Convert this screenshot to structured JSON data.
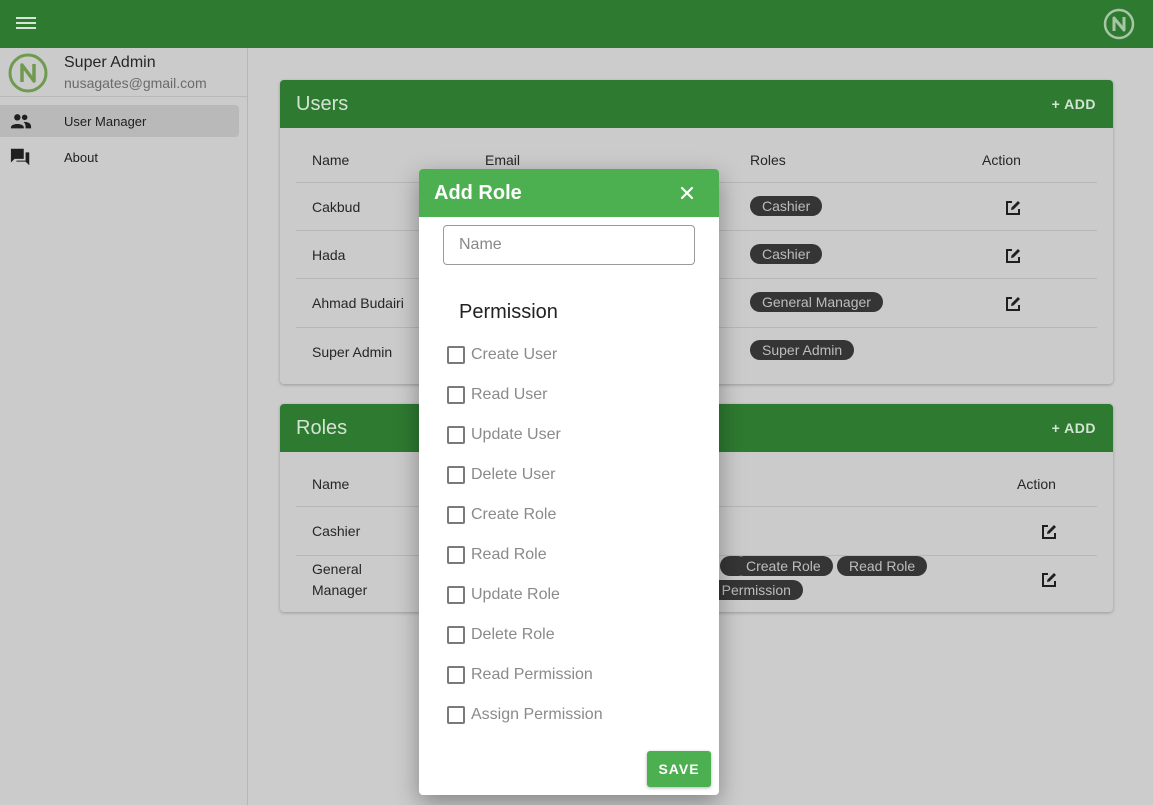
{
  "colors": {
    "primary": "#2e7a31",
    "dialog_primary": "#4caf50",
    "chip_bg": "#353535"
  },
  "appbar": {
    "menu_icon": "menu-icon",
    "logo_icon": "brand-logo-icon"
  },
  "sidebar": {
    "profile": {
      "name": "Super Admin",
      "email": "nusagates@gmail.com"
    },
    "items": [
      {
        "label": "User Manager",
        "icon": "people-icon",
        "active": true
      },
      {
        "label": "About",
        "icon": "forum-icon",
        "active": false
      }
    ]
  },
  "users_card": {
    "title": "Users",
    "add_label": "+ ADD",
    "headers": {
      "name": "Name",
      "email": "Email",
      "roles": "Roles",
      "action": "Action"
    },
    "rows": [
      {
        "name": "Cakbud",
        "role": "Cashier"
      },
      {
        "name": "Hada",
        "role": "Cashier"
      },
      {
        "name": "Ahmad Budairi",
        "role": "General Manager"
      },
      {
        "name": "Super Admin",
        "role": "Super Admin"
      }
    ]
  },
  "roles_card": {
    "title": "Roles",
    "add_label": "+ ADD",
    "headers": {
      "name": "Name",
      "action": "Action"
    },
    "rows": [
      {
        "name": "Cashier",
        "permissions": []
      },
      {
        "name_line1": "General",
        "name_line2": "Manager",
        "permissions": [
          "Create Role",
          "Read Role",
          "n Permission"
        ]
      }
    ]
  },
  "dialog": {
    "title": "Add Role",
    "close_icon": "close-icon",
    "name_placeholder": "Name",
    "permission_title": "Permission",
    "permissions": [
      "Create User",
      "Read User",
      "Update User",
      "Delete User",
      "Create Role",
      "Read Role",
      "Update Role",
      "Delete Role",
      "Read Permission",
      "Assign Permission"
    ],
    "save_label": "SAVE"
  }
}
